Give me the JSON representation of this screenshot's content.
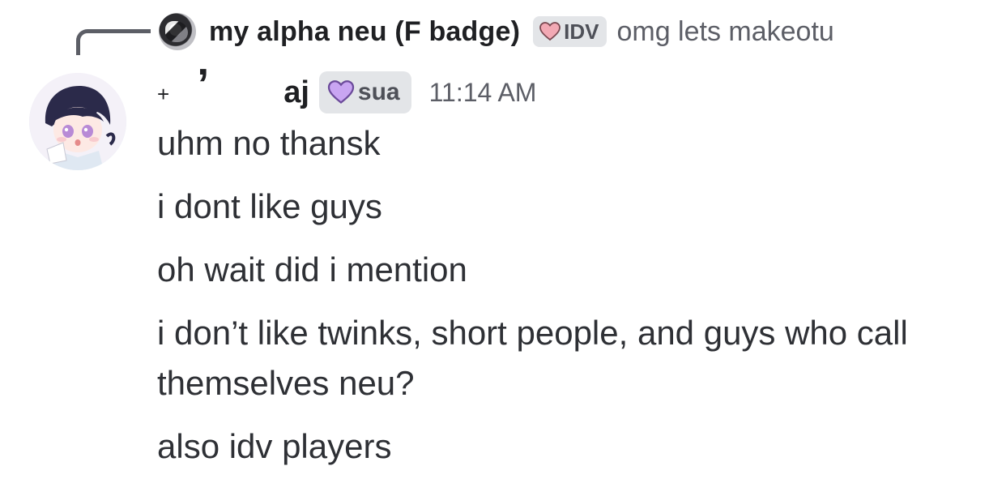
{
  "reply": {
    "author": "my alpha neu (F badge)",
    "tag": "IDV",
    "tag_icon": "heart-pink-icon",
    "preview": "omg lets makeotu"
  },
  "message": {
    "decor_plus": "+",
    "decor_comma": "’",
    "author": "aj",
    "tag": "sua",
    "tag_icon": "heart-purple-icon",
    "timestamp": "11:14 AM",
    "lines": [
      "uhm no thansk",
      "i dont like guys",
      "oh wait did i mention",
      "i don’t like twinks, short people, and guys who call",
      "themselves neu?",
      "also idv players"
    ]
  },
  "colors": {
    "chip_bg": "#e3e5e8",
    "text": "#2e3035",
    "muted": "#5c5e66",
    "heart_pink": "#f2a9b4",
    "heart_purple": "#c9a5f2"
  }
}
